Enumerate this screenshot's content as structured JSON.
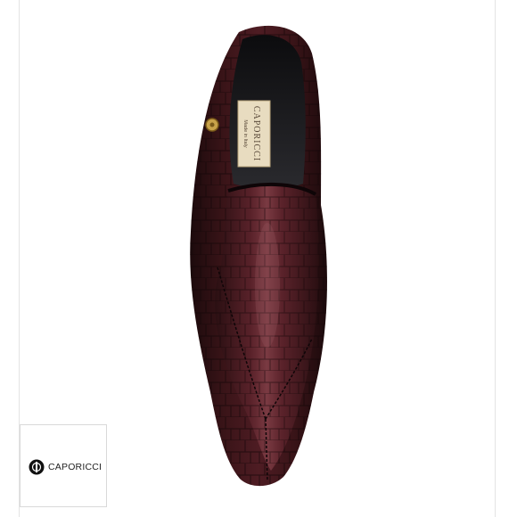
{
  "product": {
    "brand": "CAPORICCI",
    "insole_label": {
      "brand": "CAPORICCI",
      "origin": "Made in Italy"
    },
    "colors": {
      "leather_dark": "#2a0f12",
      "leather_mid": "#4a1a20",
      "leather_highlight": "#7a3a42",
      "insole_label_bg": "#e8dcc0",
      "ornament_gold": "#c8a24a"
    }
  },
  "badge": {
    "brand_text": "CAPORICCI",
    "logo_icon": "caporicci-logo-icon"
  }
}
